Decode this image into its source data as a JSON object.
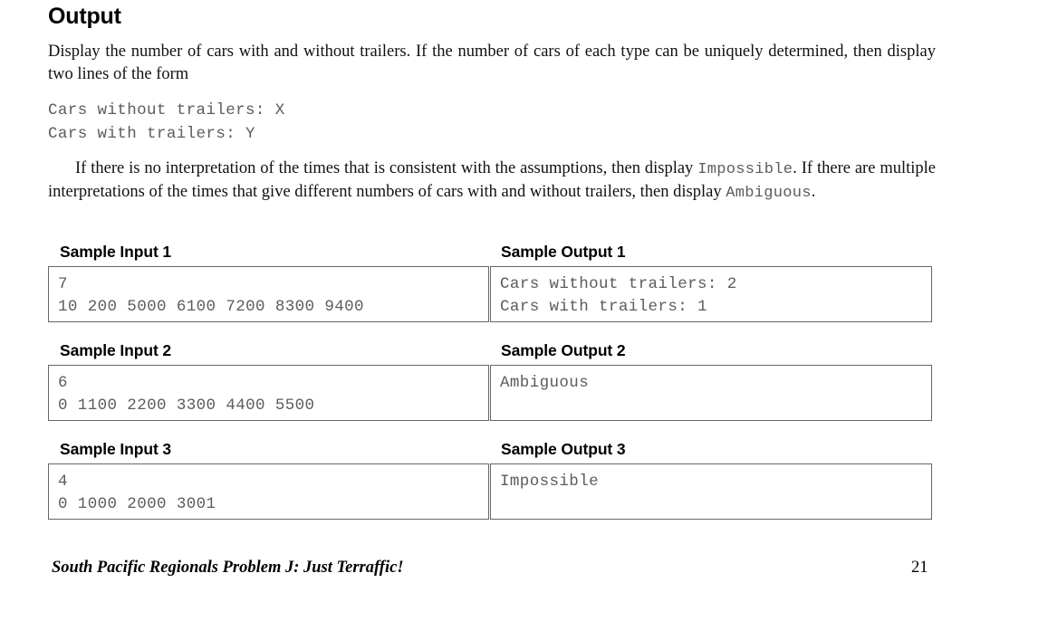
{
  "section": {
    "heading": "Output"
  },
  "paragraphs": {
    "p1_text": "Display the number of cars with and without trailers. If the number of cars of each type can be uniquely determined, then display two lines of the form",
    "p2_part1": "If there is no interpretation of the times that is consistent with the assumptions, then display ",
    "p2_mono1": "Impossible",
    "p2_part2": ". If there are multiple interpretations of the times that give different numbers of cars with and without trailers, then display ",
    "p2_mono2": "Ambiguous",
    "p2_part3": "."
  },
  "code_block": {
    "line1": "Cars without trailers: X",
    "line2": "Cars with trailers: Y"
  },
  "samples": [
    {
      "input_label": "Sample Input 1",
      "output_label": "Sample Output 1",
      "input_line1": "7",
      "input_line2": "10 200 5000 6100 7200 8300 9400",
      "output_line1": "Cars without trailers: 2",
      "output_line2": "Cars with trailers: 1"
    },
    {
      "input_label": "Sample Input 2",
      "output_label": "Sample Output 2",
      "input_line1": "6",
      "input_line2": "0 1100 2200 3300 4400 5500",
      "output_line1": "Ambiguous",
      "output_line2": ""
    },
    {
      "input_label": "Sample Input 3",
      "output_label": "Sample Output 3",
      "input_line1": "4",
      "input_line2": "0 1000 2000 3001",
      "output_line1": "Impossible",
      "output_line2": ""
    }
  ],
  "footer": {
    "title": "South Pacific Regionals Problem J: Just Terraffic!",
    "page_number": "21"
  },
  "colors": {
    "text": "#000000",
    "mono_text": "#5c5c5c",
    "box_border": "#666666",
    "background": "#ffffff"
  }
}
